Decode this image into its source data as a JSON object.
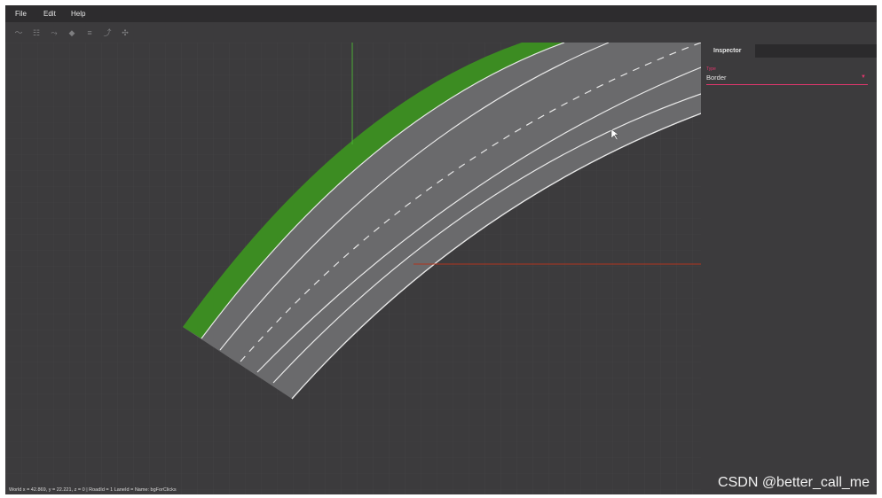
{
  "menu": {
    "items": [
      {
        "label": "File"
      },
      {
        "label": "Edit"
      },
      {
        "label": "Help"
      }
    ]
  },
  "toolbar": {
    "icons": [
      "polyline-icon",
      "list-icon",
      "route-icon",
      "layers-icon",
      "lanes-icon",
      "curve-icon",
      "junction-icon"
    ]
  },
  "inspector": {
    "tab_label": "Inspector",
    "field_label": "Type",
    "field_value": "Border"
  },
  "status": {
    "text": "World x = 42.869, y = 22.221, z = 0 | RoadId = 1 LaneId = Name: bgForClicks"
  },
  "watermark": "CSDN @better_call_me",
  "colors": {
    "background": "#3c3b3d",
    "grass": "#3c8c22",
    "road": "#6a6a6c",
    "accent": "#e0366d"
  }
}
